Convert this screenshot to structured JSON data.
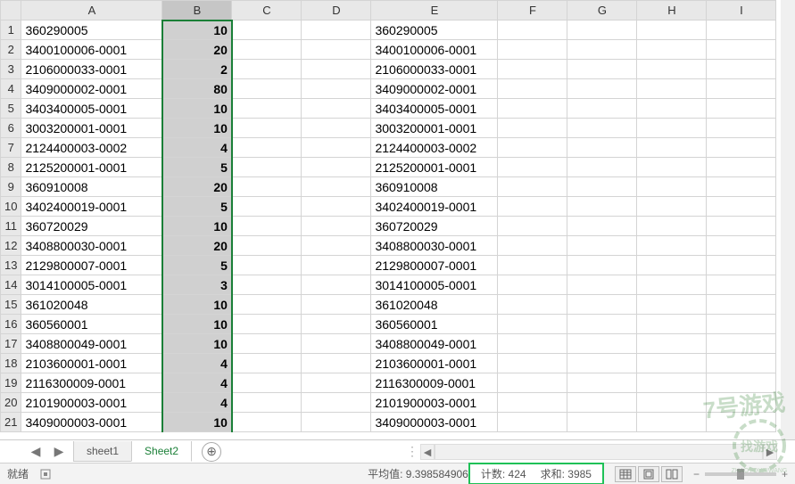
{
  "columns": [
    "A",
    "B",
    "C",
    "D",
    "E",
    "F",
    "G",
    "H",
    "I"
  ],
  "selected_column": "B",
  "rows": [
    {
      "n": 1,
      "A": "360290005",
      "B": "10",
      "E": "360290005"
    },
    {
      "n": 2,
      "A": "3400100006-0001",
      "B": "20",
      "E": "3400100006-0001"
    },
    {
      "n": 3,
      "A": "2106000033-0001",
      "B": "2",
      "E": "2106000033-0001"
    },
    {
      "n": 4,
      "A": "3409000002-0001",
      "B": "80",
      "E": "3409000002-0001"
    },
    {
      "n": 5,
      "A": "3403400005-0001",
      "B": "10",
      "E": "3403400005-0001"
    },
    {
      "n": 6,
      "A": "3003200001-0001",
      "B": "10",
      "E": "3003200001-0001"
    },
    {
      "n": 7,
      "A": "2124400003-0002",
      "B": "4",
      "E": "2124400003-0002"
    },
    {
      "n": 8,
      "A": "2125200001-0001",
      "B": "5",
      "E": "2125200001-0001"
    },
    {
      "n": 9,
      "A": "360910008",
      "B": "20",
      "E": "360910008"
    },
    {
      "n": 10,
      "A": "3402400019-0001",
      "B": "5",
      "E": "3402400019-0001"
    },
    {
      "n": 11,
      "A": "360720029",
      "B": "10",
      "E": "360720029"
    },
    {
      "n": 12,
      "A": "3408800030-0001",
      "B": "20",
      "E": "3408800030-0001"
    },
    {
      "n": 13,
      "A": "2129800007-0001",
      "B": "5",
      "E": "2129800007-0001"
    },
    {
      "n": 14,
      "A": "3014100005-0001",
      "B": "3",
      "E": "3014100005-0001"
    },
    {
      "n": 15,
      "A": "361020048",
      "B": "10",
      "E": "361020048"
    },
    {
      "n": 16,
      "A": "360560001",
      "B": "10",
      "E": "360560001"
    },
    {
      "n": 17,
      "A": "3408800049-0001",
      "B": "10",
      "E": "3408800049-0001"
    },
    {
      "n": 18,
      "A": "2103600001-0001",
      "B": "4",
      "E": "2103600001-0001"
    },
    {
      "n": 19,
      "A": "2116300009-0001",
      "B": "4",
      "E": "2116300009-0001"
    },
    {
      "n": 20,
      "A": "2101900003-0001",
      "B": "4",
      "E": "2101900003-0001"
    },
    {
      "n": 21,
      "A": "3409000003-0001",
      "B": "10",
      "E": "3409000003-0001"
    }
  ],
  "sheet_tabs": {
    "tabs": [
      "sheet1",
      "Sheet2"
    ],
    "active": "Sheet2",
    "add_label": "+"
  },
  "status": {
    "ready": "就绪",
    "avg_label": "平均值:",
    "avg_value": "9.398584906",
    "count_label": "计数:",
    "count_value": "424",
    "sum_label": "求和:",
    "sum_value": "3985"
  },
  "watermark": {
    "brand1_cn": "7号游戏",
    "brand2_cn": "找游戏网",
    "brand2_py": "ZHAOYOUXIWANG"
  },
  "icons": {
    "nav_left": "◀",
    "nav_right": "▶",
    "plus": "⊕",
    "scroll_left": "◄",
    "scroll_right": "►",
    "zoom_minus": "−",
    "zoom_plus": "+"
  }
}
